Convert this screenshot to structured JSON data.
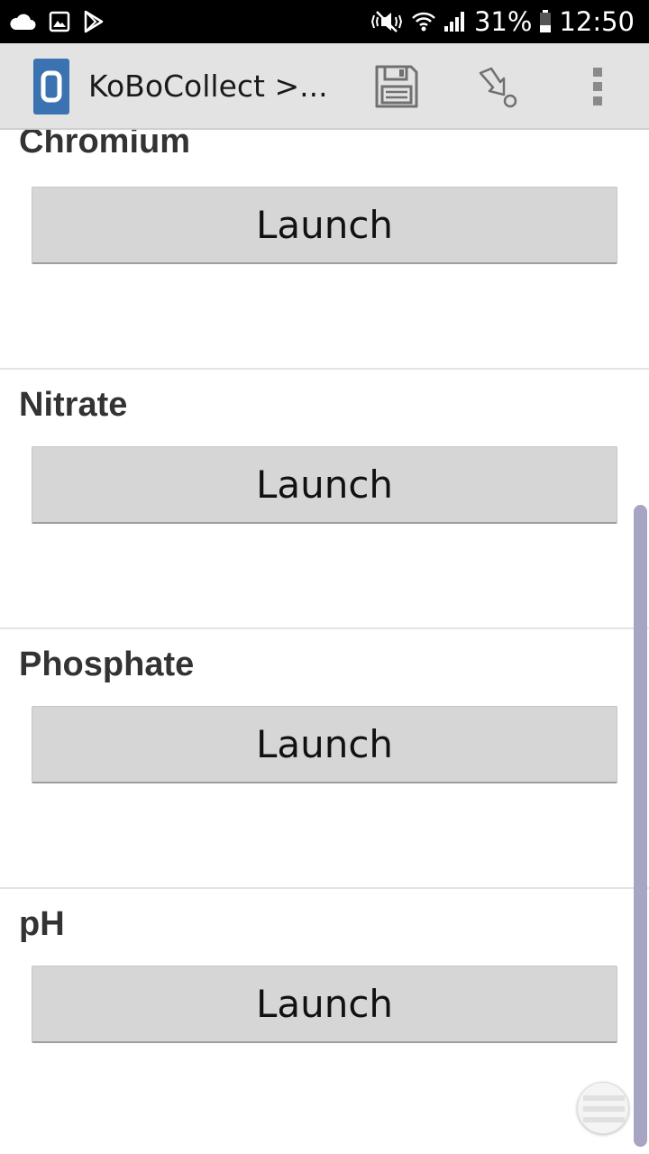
{
  "status_bar": {
    "battery": "31%",
    "time": "12:50",
    "icons": [
      "cloud-icon",
      "image-icon",
      "play-store-icon",
      "mute-icon",
      "wifi-icon",
      "signal-icon",
      "battery-icon"
    ]
  },
  "action_bar": {
    "title": "KoBoCollect >...",
    "logo_letter": "0",
    "actions": [
      "save-icon",
      "go-to-prompt-icon",
      "overflow-menu-icon"
    ],
    "logo_color": "#3b72b1"
  },
  "questions": [
    {
      "label": "Chromium",
      "button_label": "Launch"
    },
    {
      "label": "Nitrate",
      "button_label": "Launch"
    },
    {
      "label": "Phosphate",
      "button_label": "Launch"
    },
    {
      "label": "pH",
      "button_label": "Launch"
    }
  ],
  "colors": {
    "status_bar": "#000000",
    "action_bar": "#e3e3e3",
    "button": "#d6d6d6",
    "scrollbar": "#a6a6c4"
  }
}
